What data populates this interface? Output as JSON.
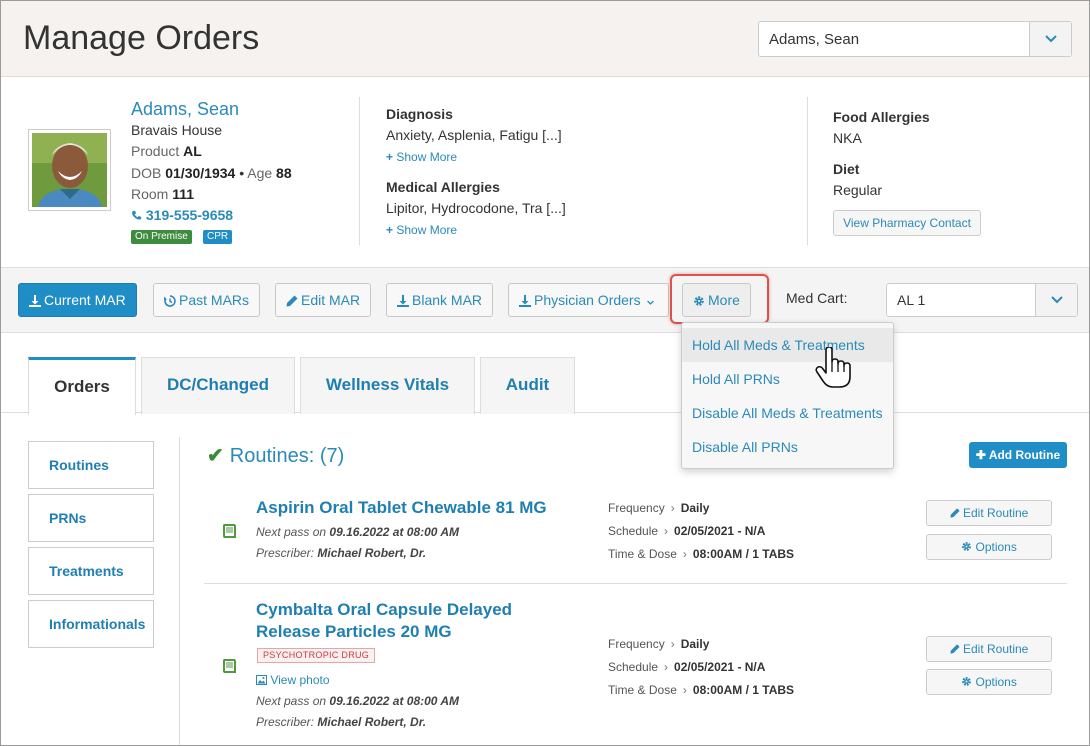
{
  "header": {
    "title": "Manage Orders",
    "patient_select": "Adams, Sean"
  },
  "patient": {
    "name": "Adams, Sean",
    "facility": "Bravais House",
    "product_label": "Product",
    "product": "AL",
    "dob_label": "DOB",
    "dob": "01/30/1934",
    "bullet": "•",
    "age_label": "Age",
    "age": "88",
    "room_label": "Room",
    "room": "111",
    "phone": "319-555-9658",
    "badges": [
      {
        "label": "On Premise",
        "color": "#3d8b3d"
      },
      {
        "label": "CPR",
        "color": "#1f8dc6"
      }
    ]
  },
  "clinical": {
    "diagnosis_label": "Diagnosis",
    "diagnosis": "Anxiety, Asplenia, Fatigu [...]",
    "show_more_1": "Show More",
    "allergies_label": "Medical Allergies",
    "allergies": "Lipitor, Hydrocodone, Tra [...]",
    "show_more_2": "Show More",
    "food_allergies_label": "Food Allergies",
    "food_allergies": "NKA",
    "diet_label": "Diet",
    "diet": "Regular",
    "pharmacy_button": "View Pharmacy Contact"
  },
  "toolbar": {
    "current_mar": "Current MAR",
    "past_mars": "Past MARs",
    "edit_mar": "Edit MAR",
    "blank_mar": "Blank MAR",
    "physician_orders": "Physician Orders",
    "more": "More",
    "med_cart_label": "Med Cart:",
    "med_cart_value": "AL 1"
  },
  "more_menu": {
    "items": [
      "Hold All Meds & Treatments",
      "Hold All PRNs",
      "Disable All Meds & Treatments",
      "Disable All PRNs"
    ]
  },
  "tabs": [
    "Orders",
    "DC/Changed",
    "Wellness Vitals",
    "Audit"
  ],
  "sidebar": [
    "Routines",
    "PRNs",
    "Treatments",
    "Informationals"
  ],
  "routines": {
    "title": "Routines: (7)",
    "add_button": "Add Routine",
    "items": [
      {
        "name": "Aspirin Oral Tablet Chewable 81 MG",
        "next_pass_label": "Next pass on",
        "next_pass": "09.16.2022 at 08:00 AM",
        "prescriber_label": "Prescriber:",
        "prescriber": "Michael Robert, Dr.",
        "frequency_label": "Frequency",
        "frequency": "Daily",
        "schedule_label": "Schedule",
        "schedule": "02/05/2021 - N/A",
        "time_dose_label": "Time & Dose",
        "time_dose": "08:00AM / 1 TABS",
        "edit_button": "Edit Routine",
        "options_button": "Options"
      },
      {
        "name_line1": "Cymbalta Oral Capsule Delayed",
        "name_line2": "Release Particles 20 MG",
        "tag": "PSYCHOTROPIC DRUG",
        "view_photo": "View photo",
        "next_pass_label": "Next pass on",
        "next_pass": "09.16.2022 at 08:00 AM",
        "prescriber_label": "Prescriber:",
        "prescriber": "Michael Robert, Dr.",
        "frequency_label": "Frequency",
        "frequency": "Daily",
        "schedule_label": "Schedule",
        "schedule": "02/05/2021 - N/A",
        "time_dose_label": "Time & Dose",
        "time_dose": "08:00AM / 1 TABS",
        "edit_button": "Edit Routine",
        "options_button": "Options"
      }
    ]
  }
}
